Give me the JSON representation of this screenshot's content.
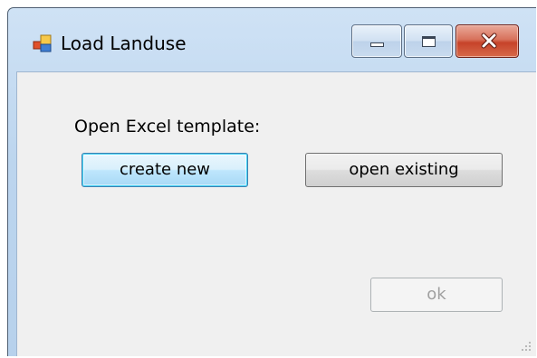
{
  "window": {
    "title": "Load Landuse",
    "app_icon": "form-icon",
    "controls": [
      "minimize-icon",
      "maximize-icon",
      "close-icon"
    ]
  },
  "content": {
    "prompt_label": "Open Excel template:",
    "create_new_label": "create new",
    "open_existing_label": "open existing",
    "ok_label": "ok",
    "ok_enabled": false,
    "focused_button": "create new"
  },
  "colors": {
    "client_background": "#f0f0f0",
    "focus_border": "#3c7fb1",
    "close_button": "#c7432a"
  }
}
